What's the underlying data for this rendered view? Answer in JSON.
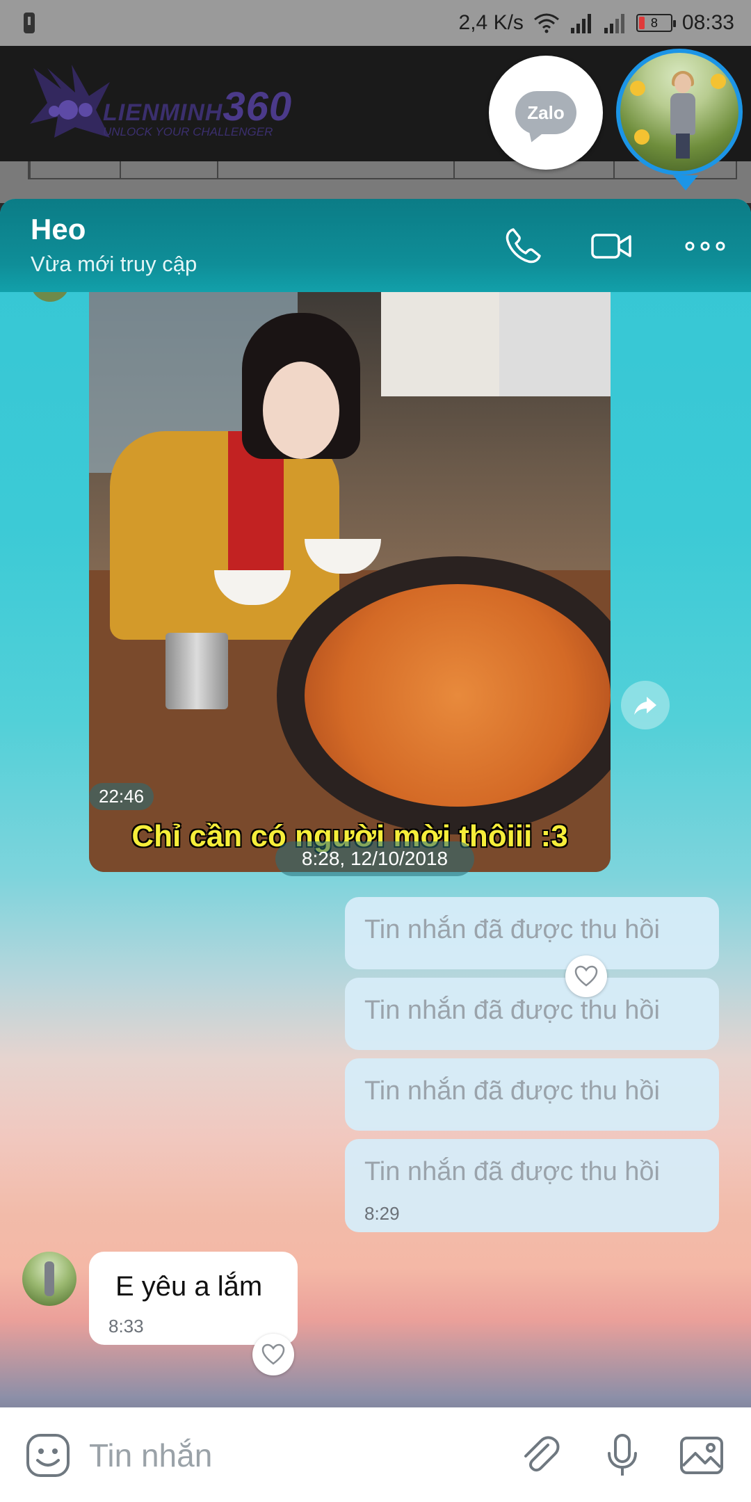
{
  "status_bar": {
    "speed": "2,4 K/s",
    "battery_level": "8",
    "time": "08:33"
  },
  "background_app": {
    "brand": "LIENMINH",
    "brand_number": "360",
    "tagline": "UNLOCK YOUR CHALLENGER"
  },
  "chat_heads": {
    "zalo_label": "Zalo"
  },
  "chat": {
    "contact_name": "Heo",
    "contact_status": "Vừa mới truy cập",
    "photo_caption": "Chỉ cần có người mời thôiii :3",
    "photo_top_caption": "...",
    "photo_time": "22:46",
    "date_separator": "8:28, 12/10/2018",
    "recalled_messages": [
      {
        "text": "Tin nhắn đã được thu hồi"
      },
      {
        "text": "Tin nhắn đã được thu hồi"
      },
      {
        "text": "Tin nhắn đã được thu hồi"
      },
      {
        "text": "Tin nhắn đã được thu hồi",
        "time": "8:29"
      }
    ],
    "incoming_message": {
      "text": "E yêu a lắm",
      "time": "8:33"
    }
  },
  "input_bar": {
    "placeholder": "Tin nhắn"
  },
  "colors": {
    "header": "#0f8e98",
    "accent_blue": "#1c95e6",
    "recalled_bubble": "#d6ecf8"
  }
}
